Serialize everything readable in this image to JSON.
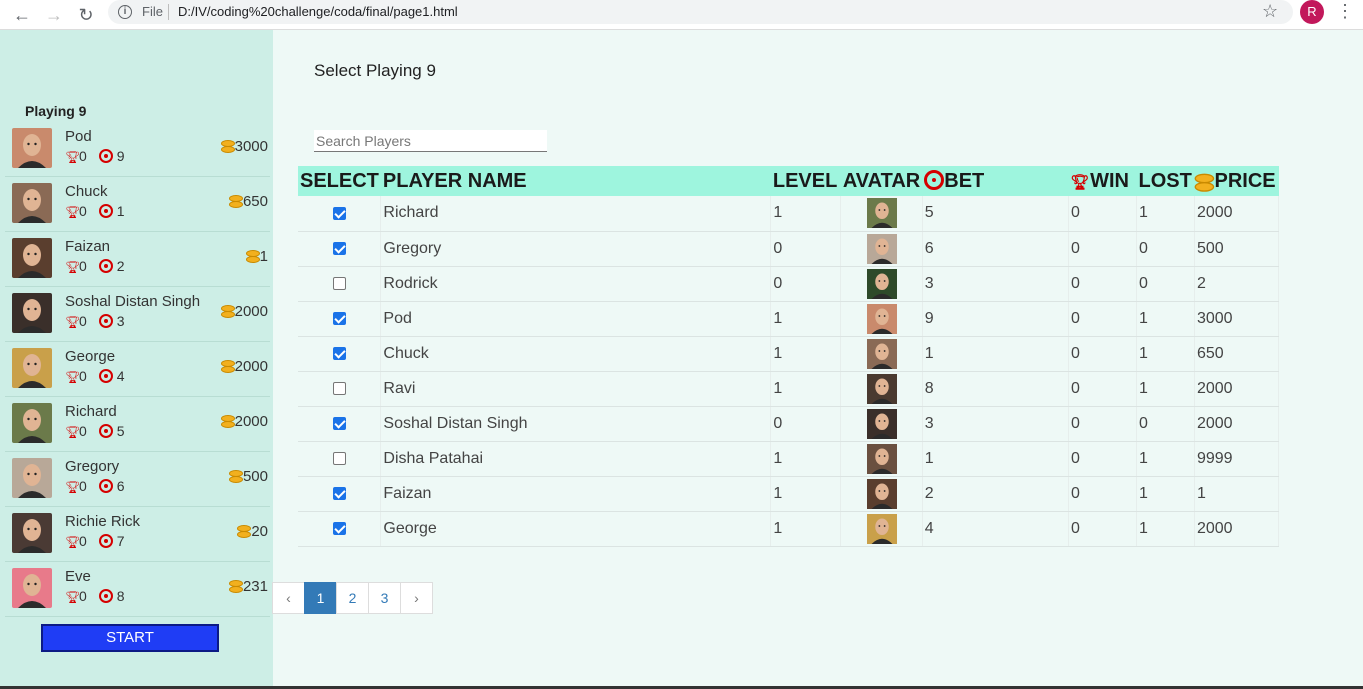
{
  "browser": {
    "file_label": "File",
    "url": "D:/IV/coding%20challenge/coda/final/page1.html",
    "profile_initial": "R"
  },
  "sidebar": {
    "title": "Playing 9",
    "start_label": "START",
    "players": [
      {
        "name": "Pod",
        "wins": "0",
        "bet": "9",
        "price": "3000",
        "avatar": "#c98a6c"
      },
      {
        "name": "Chuck",
        "wins": "0",
        "bet": "1",
        "price": "650",
        "avatar": "#8a6a55"
      },
      {
        "name": "Faizan",
        "wins": "0",
        "bet": "2",
        "price": "1",
        "avatar": "#5a3e2e"
      },
      {
        "name": "Soshal Distan Singh",
        "wins": "0",
        "bet": "3",
        "price": "2000",
        "avatar": "#3a2f2a"
      },
      {
        "name": "George",
        "wins": "0",
        "bet": "4",
        "price": "2000",
        "avatar": "#c9a04a"
      },
      {
        "name": "Richard",
        "wins": "0",
        "bet": "5",
        "price": "2000",
        "avatar": "#6b7a4a"
      },
      {
        "name": "Gregory",
        "wins": "0",
        "bet": "6",
        "price": "500",
        "avatar": "#b8a898"
      },
      {
        "name": "Richie Rick",
        "wins": "0",
        "bet": "7",
        "price": "20",
        "avatar": "#4a3a34"
      },
      {
        "name": "Eve",
        "wins": "0",
        "bet": "8",
        "price": "231",
        "avatar": "#e87a8a"
      }
    ]
  },
  "main": {
    "title": "Select Playing 9",
    "search_placeholder": "Search Players",
    "columns": [
      "SELECT",
      "PLAYER NAME",
      "LEVEL",
      "AVATAR",
      "BET",
      "WIN",
      "LOST",
      "PRICE"
    ],
    "rows": [
      {
        "checked": true,
        "name": "Richard",
        "level": "1",
        "bet": "5",
        "win": "0",
        "lost": "1",
        "price": "2000",
        "avatar": "#6b7a4a"
      },
      {
        "checked": true,
        "name": "Gregory",
        "level": "0",
        "bet": "6",
        "win": "0",
        "lost": "0",
        "price": "500",
        "avatar": "#b8a898"
      },
      {
        "checked": false,
        "name": "Rodrick",
        "level": "0",
        "bet": "3",
        "win": "0",
        "lost": "0",
        "price": "2",
        "avatar": "#2e4a2a"
      },
      {
        "checked": true,
        "name": "Pod",
        "level": "1",
        "bet": "9",
        "win": "0",
        "lost": "1",
        "price": "3000",
        "avatar": "#c98a6c"
      },
      {
        "checked": true,
        "name": "Chuck",
        "level": "1",
        "bet": "1",
        "win": "0",
        "lost": "1",
        "price": "650",
        "avatar": "#8a6a55"
      },
      {
        "checked": false,
        "name": "Ravi",
        "level": "1",
        "bet": "8",
        "win": "0",
        "lost": "1",
        "price": "2000",
        "avatar": "#4a3a30"
      },
      {
        "checked": true,
        "name": "Soshal Distan Singh",
        "level": "0",
        "bet": "3",
        "win": "0",
        "lost": "0",
        "price": "2000",
        "avatar": "#3a2f2a"
      },
      {
        "checked": false,
        "name": "Disha Patahai",
        "level": "1",
        "bet": "1",
        "win": "0",
        "lost": "1",
        "price": "9999",
        "avatar": "#6a5040"
      },
      {
        "checked": true,
        "name": "Faizan",
        "level": "1",
        "bet": "2",
        "win": "0",
        "lost": "1",
        "price": "1",
        "avatar": "#5a3e2e"
      },
      {
        "checked": true,
        "name": "George",
        "level": "1",
        "bet": "4",
        "win": "0",
        "lost": "1",
        "price": "2000",
        "avatar": "#c9a04a"
      }
    ]
  },
  "pagination": {
    "prev": "‹",
    "pages": [
      "1",
      "2",
      "3"
    ],
    "active_page": "1",
    "next": "›"
  }
}
